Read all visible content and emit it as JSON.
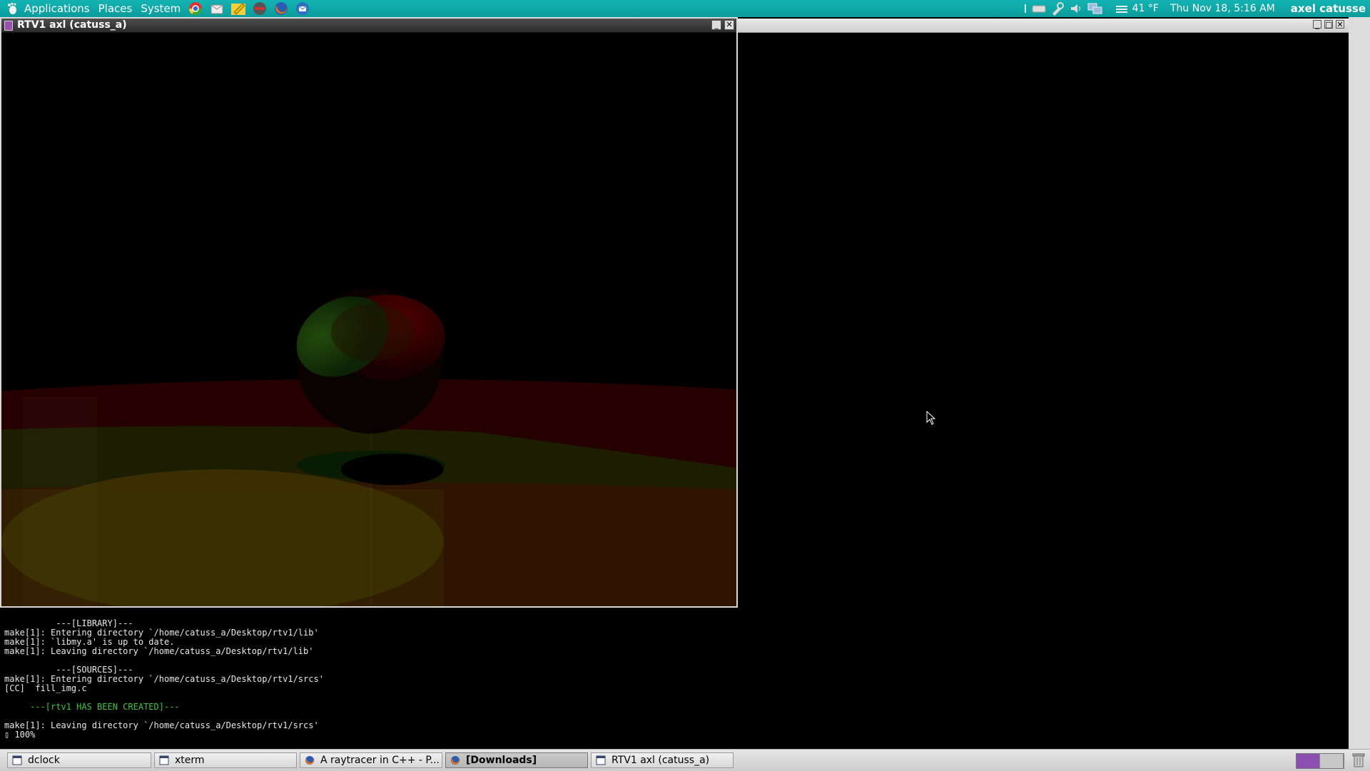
{
  "top_panel": {
    "menus": [
      "Applications",
      "Places",
      "System"
    ],
    "launchers": [
      "chrome-icon",
      "mail-icon",
      "notes-icon",
      "terminal-icon",
      "firefox-icon",
      "thunderbird-icon"
    ],
    "weather": "41 °F",
    "datetime": "Thu Nov 18,  5:16 AM",
    "user": "axel catusse"
  },
  "render_window": {
    "title": "RTV1 axl (catuss_a)",
    "buttons": [
      "minimize",
      "close"
    ]
  },
  "terminal": {
    "lines": [
      {
        "text": "          ---[LIBRARY]---",
        "color": "default"
      },
      {
        "text": "make[1]: Entering directory `/home/catuss_a/Desktop/rtv1/lib'",
        "color": "default"
      },
      {
        "text": "make[1]: `libmy.a' is up to date.",
        "color": "default"
      },
      {
        "text": "make[1]: Leaving directory `/home/catuss_a/Desktop/rtv1/lib'",
        "color": "default"
      },
      {
        "text": "",
        "color": "default"
      },
      {
        "text": "          ---[SOURCES]---",
        "color": "default"
      },
      {
        "text": "make[1]: Entering directory `/home/catuss_a/Desktop/rtv1/srcs'",
        "color": "default"
      },
      {
        "text": "[CC]  fill_img.c",
        "color": "default"
      },
      {
        "text": "",
        "color": "default"
      },
      {
        "text": "     ---[rtv1 HAS BEEN CREATED]---",
        "color": "green"
      },
      {
        "text": "",
        "color": "default"
      },
      {
        "text": "make[1]: Leaving directory `/home/catuss_a/Desktop/rtv1/srcs'",
        "color": "default"
      },
      {
        "text": "▯ 100%",
        "color": "default"
      }
    ]
  },
  "taskbar": {
    "tasks": [
      {
        "label": "dclock",
        "icon": "window-icon",
        "active": false
      },
      {
        "label": "xterm",
        "icon": "window-icon",
        "active": false
      },
      {
        "label": "A raytracer in C++ - P...",
        "icon": "firefox-icon",
        "active": false
      },
      {
        "label": "[Downloads]",
        "icon": "firefox-icon",
        "active": true
      },
      {
        "label": "RTV1 axl (catuss_a)",
        "icon": "window-icon",
        "active": false
      }
    ],
    "workspaces": {
      "count": 2,
      "active": 1
    }
  },
  "colors": {
    "panel": "#11a8a8",
    "scene_red": "#5a0000",
    "scene_green": "#0a3a06",
    "scene_yellow": "#3a3a00",
    "terminal_green": "#3ec43e"
  }
}
